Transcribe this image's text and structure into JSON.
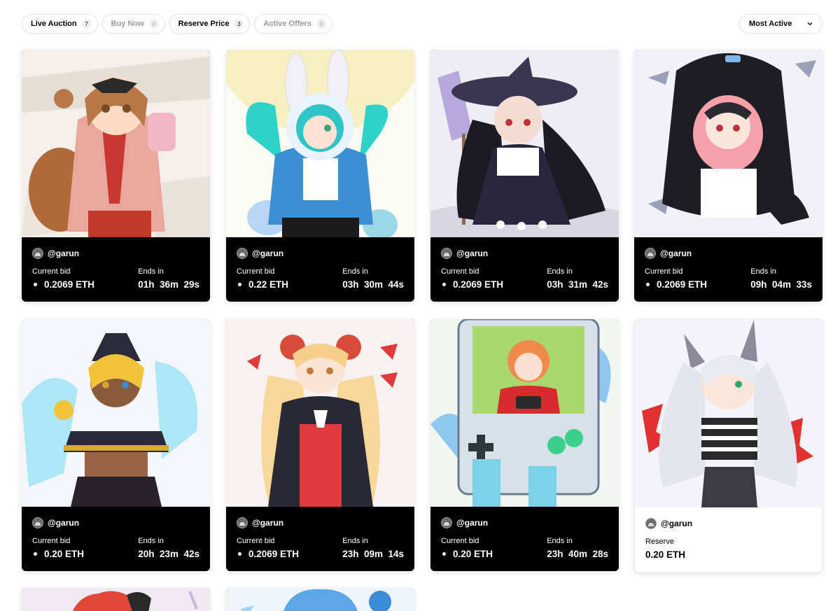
{
  "filters": [
    {
      "label": "Live Auction",
      "count": "7",
      "active": true
    },
    {
      "label": "Buy Now",
      "count": "0",
      "active": false
    },
    {
      "label": "Reserve Price",
      "count": "3",
      "active": true
    },
    {
      "label": "Active Offers",
      "count": "0",
      "active": false
    }
  ],
  "sort": {
    "label": "Most Active"
  },
  "cards": [
    {
      "creator": "@garun",
      "label": "Current bid",
      "value": "0.2069 ETH",
      "ends_label": "Ends in",
      "ends": "01h  36m  29s"
    },
    {
      "creator": "@garun",
      "label": "Current bid",
      "value": "0.22 ETH",
      "ends_label": "Ends in",
      "ends": "03h  30m  44s"
    },
    {
      "creator": "@garun",
      "label": "Current bid",
      "value": "0.2069 ETH",
      "ends_label": "Ends in",
      "ends": "03h  31m  42s"
    },
    {
      "creator": "@garun",
      "label": "Current bid",
      "value": "0.2069 ETH",
      "ends_label": "Ends in",
      "ends": "09h  04m  33s"
    },
    {
      "creator": "@garun",
      "label": "Current bid",
      "value": "0.20 ETH",
      "ends_label": "Ends in",
      "ends": "20h  23m  42s"
    },
    {
      "creator": "@garun",
      "label": "Current bid",
      "value": "0.2069 ETH",
      "ends_label": "Ends in",
      "ends": "23h  09m  14s"
    },
    {
      "creator": "@garun",
      "label": "Current bid",
      "value": "0.20 ETH",
      "ends_label": "Ends in",
      "ends": "23h  40m  28s"
    },
    {
      "creator": "@garun",
      "label": "Reserve",
      "value": "0.20 ETH"
    }
  ],
  "colors": {
    "accent": "#000000",
    "card_dark": "#000000",
    "border": "#e6e6e6"
  },
  "icons": {
    "sort": "chevron-down-icon",
    "avatar": "avatar-icon",
    "bid": "dot-icon"
  }
}
